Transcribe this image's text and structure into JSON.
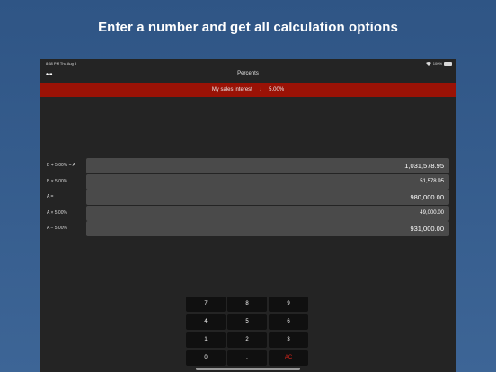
{
  "headline": "Enter a number and get all calculation options",
  "status": {
    "time": "8:58 PM Thu Aug 5",
    "battery": "100%"
  },
  "nav": {
    "more_label": "•••",
    "title": "Percents"
  },
  "banner": {
    "left": "My sales interest",
    "arrow": "↓",
    "right": "5.00%"
  },
  "rows": [
    {
      "label": "B + 5.00% = A",
      "value": "1,031,578.95"
    },
    {
      "label": "B × 5.00%",
      "value": "51,578.95"
    },
    {
      "label": "A =",
      "value": "980,000.00"
    },
    {
      "label": "A × 5.00%",
      "value": "49,000.00"
    },
    {
      "label": "A − 5.00%",
      "value": "931,000.00"
    }
  ],
  "keypad": [
    "7",
    "8",
    "9",
    "4",
    "5",
    "6",
    "1",
    "2",
    "3",
    "0",
    ".",
    "AC"
  ],
  "colors": {
    "background": "#3a6290",
    "banner": "#9a1206",
    "ac_key": "#e0251b"
  }
}
